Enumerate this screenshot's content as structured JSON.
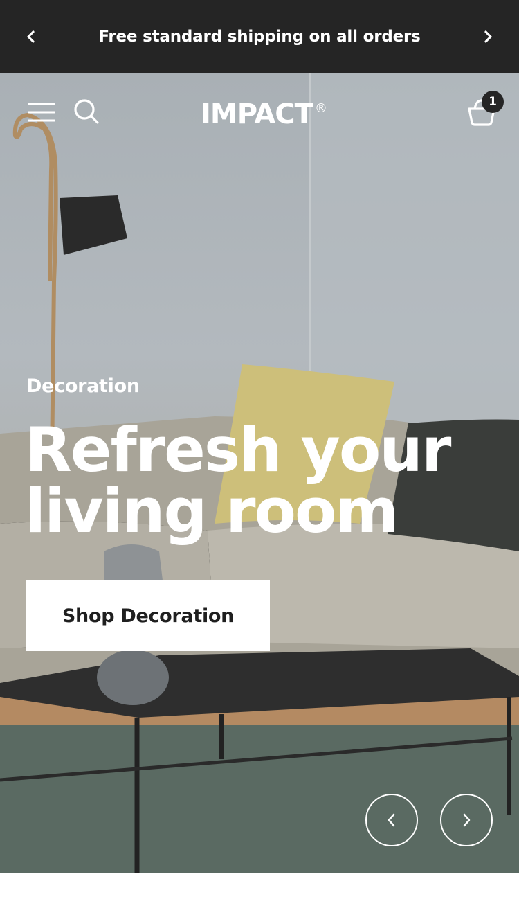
{
  "announcement": {
    "text": "Free standard shipping on all orders",
    "prev_icon": "chevron-left-icon",
    "next_icon": "chevron-right-icon"
  },
  "header": {
    "logo": "IMPACT",
    "logo_mark": "®",
    "cart_count": "1",
    "icons": [
      "menu-icon",
      "search-icon",
      "cart-icon"
    ]
  },
  "hero": {
    "kicker": "Decoration",
    "headline": "Refresh your living room",
    "cta_label": "Shop Decoration",
    "prev_icon": "chevron-left-icon",
    "next_icon": "chevron-right-icon"
  },
  "colors": {
    "announcement_bg": "#252525",
    "text_light": "#ffffff",
    "button_bg": "#ffffff",
    "button_text": "#1f1f1f"
  }
}
